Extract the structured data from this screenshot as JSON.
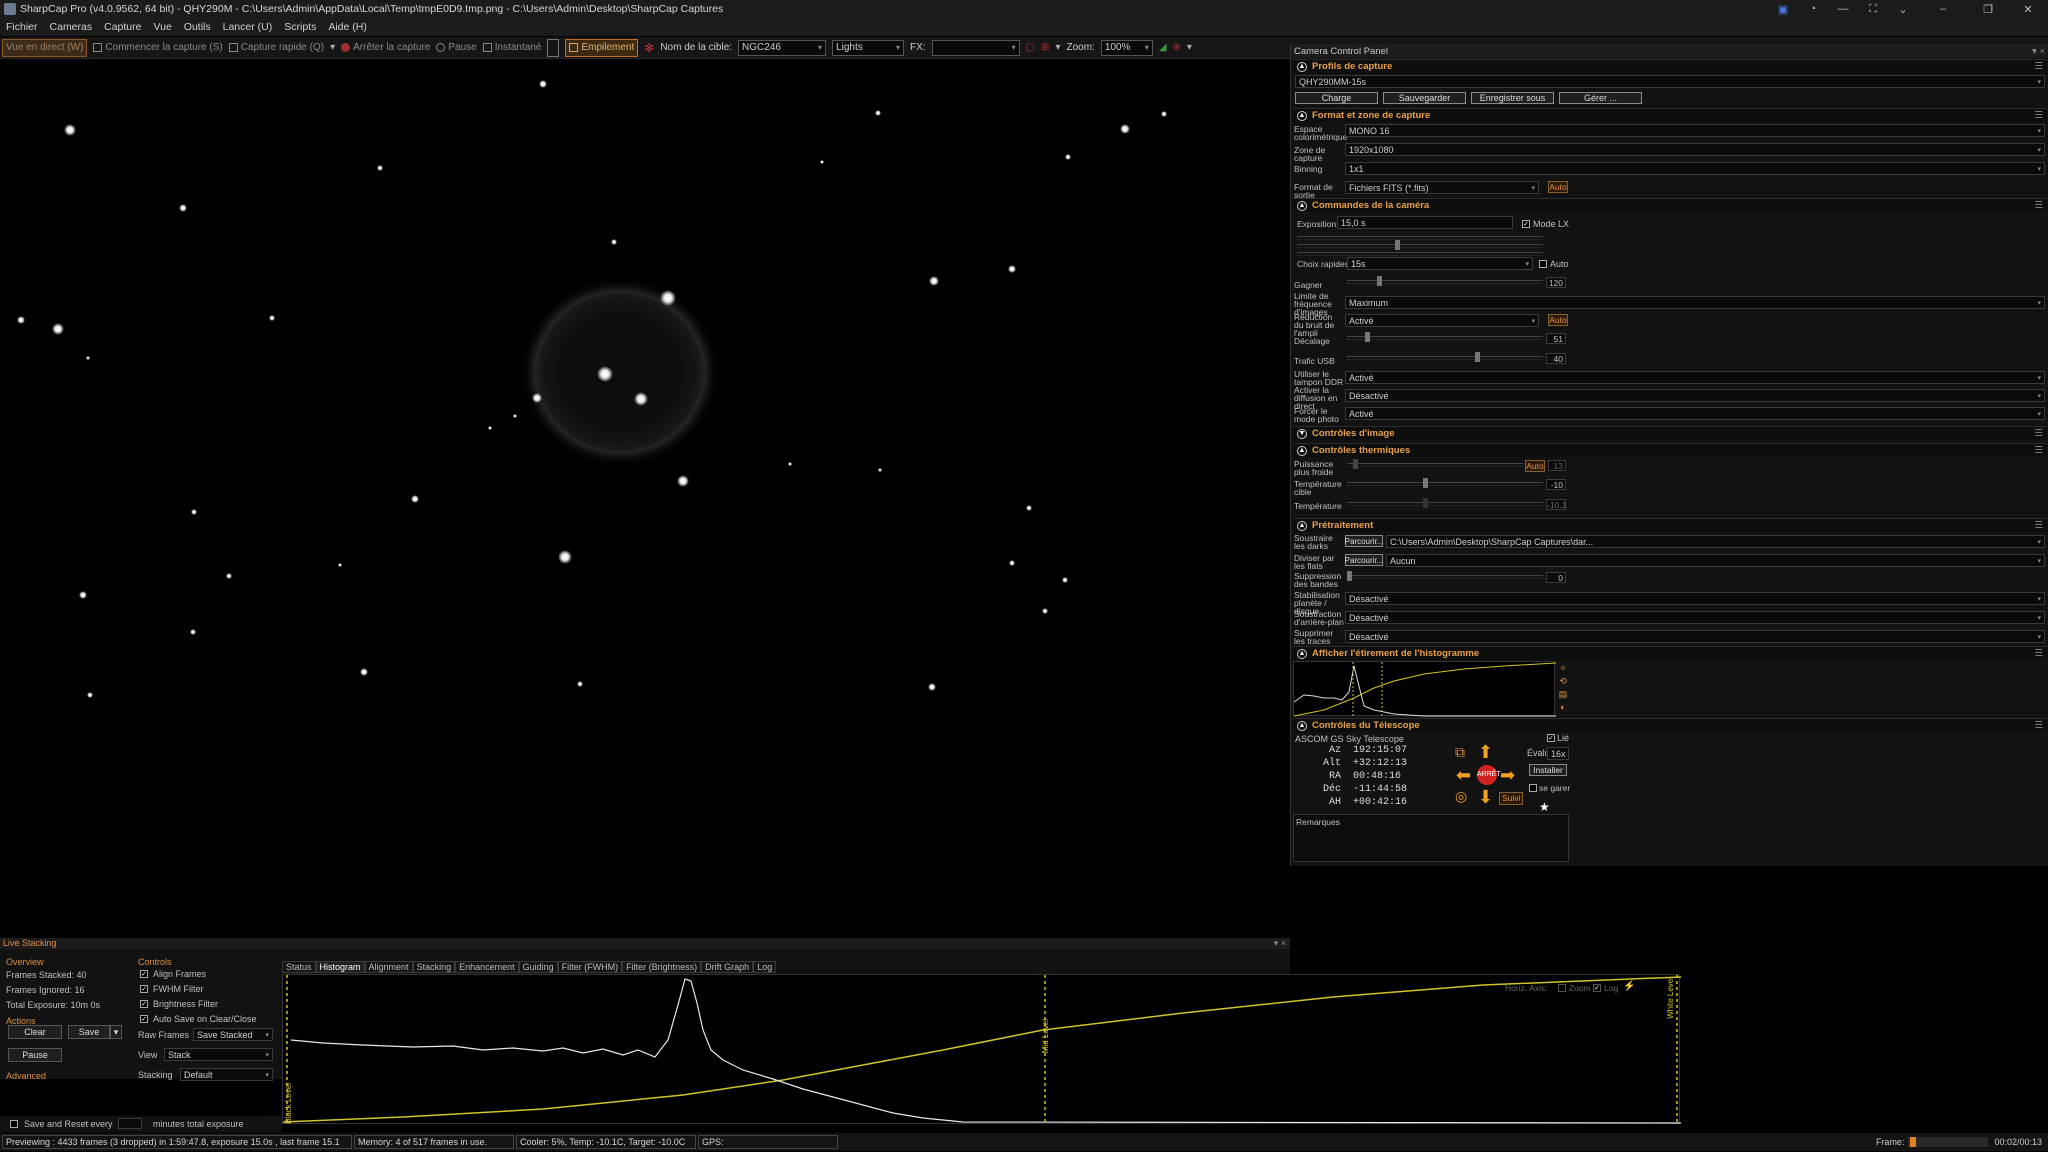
{
  "window": {
    "title": "SharpCap Pro (v4.0.9562, 64 bit) - QHY290M - C:\\Users\\Admin\\AppData\\Local\\Temp\\tmpE0D9.tmp.png - C:\\Users\\Admin\\Desktop\\SharpCap Captures"
  },
  "menu": [
    "Fichier",
    "Cameras",
    "Capture",
    "Vue",
    "Outils",
    "Lancer (U)",
    "Scripts",
    "Aide (H)"
  ],
  "toolbar": {
    "live": "Vue en direct (W)",
    "start": "Commencer la capture (S)",
    "quick": "Capture rapide (Q)",
    "stop": "Arrêter la capture",
    "pause": "Pause",
    "snapshot": "Instantané",
    "stacking": "Empilement",
    "target_label": "Nom de la cible:",
    "target": "NGC246",
    "frame_type": "Lights",
    "fx_label": "FX:",
    "fx": "",
    "zoom_label": "Zoom:",
    "zoom": "100%"
  },
  "panel": {
    "title": "Camera Control Panel",
    "profiles": {
      "header": "Profils de capture",
      "selected": "QHY290MM-15s",
      "buttons": [
        "Charge",
        "Sauvegarder",
        "Enregistrer sous",
        "Gérer ..."
      ]
    },
    "format": {
      "header": "Format et zone de capture",
      "rows": [
        {
          "label": "Espace colorimétrique",
          "value": "MONO 16"
        },
        {
          "label": "Zone de capture",
          "value": "1920x1080"
        },
        {
          "label": "Binning",
          "value": "1x1"
        },
        {
          "label": "Format de sortie",
          "value": "Fichiers FITS (*.fits)"
        }
      ],
      "auto": "Auto"
    },
    "camera": {
      "header": "Commandes de la caméra",
      "exposure_label": "Exposition",
      "exposure": "15,0 s",
      "lx_mode": "Mode LX",
      "quick_label": "Choix rapides",
      "quick": "15s",
      "auto": "Auto",
      "rows": [
        {
          "label": "Gagner",
          "value": "120"
        },
        {
          "label": "Limite de fréquence d'images",
          "value": "Maximum"
        },
        {
          "label": "Réduction du bruit de l'ampli",
          "value": "Activé"
        },
        {
          "label": "Décalage",
          "value": "51"
        },
        {
          "label": "Trafic USB",
          "value": "40"
        },
        {
          "label": "Utiliser le tampon DDR",
          "value": "Activé"
        },
        {
          "label": "Activer la diffusion en direct",
          "value": "Désactivé"
        },
        {
          "label": "Forcer le mode photo",
          "value": "Activé"
        }
      ]
    },
    "image_controls": {
      "header": "Contrôles d'image"
    },
    "thermal": {
      "header": "Contrôles thermiques",
      "rows": [
        {
          "label": "Puissance plus froide",
          "value": "13"
        },
        {
          "label": "Température cible",
          "value": "-10"
        },
        {
          "label": "Température",
          "value": "-10.1"
        }
      ],
      "auto": "Auto"
    },
    "preprocessing": {
      "header": "Prétraitement",
      "browse": "Parcourir...",
      "rows": [
        {
          "label": "Soustraire les darks",
          "value": "C:\\Users\\Admin\\Desktop\\SharpCap Captures\\dar..."
        },
        {
          "label": "Diviser par les flats",
          "value": "Aucun"
        },
        {
          "label": "Suppression des bandes",
          "value": "0"
        },
        {
          "label": "Stabilisation planète / disque",
          "value": "Désactivé"
        },
        {
          "label": "Soustraction d'arrière-plan",
          "value": "Désactivé"
        },
        {
          "label": "Supprimer les traces satellites",
          "value": "Désactivé"
        }
      ]
    },
    "histogram": {
      "header": "Afficher l'étirement de l'histogramme"
    },
    "telescope": {
      "header": "Contrôles du Télescope",
      "name": "ASCOM GS Sky Telescope",
      "linked": "Lié",
      "evaluate_label": "Évaluer:",
      "evaluate": "16x",
      "install": "Installer",
      "park": "se garer",
      "stop": "ARRÊT",
      "follow": "Suivi",
      "coords": [
        {
          "k": "Az",
          "v": "192:15:07"
        },
        {
          "k": "Alt",
          "v": "+32:12:13"
        },
        {
          "k": "RA",
          "v": "00:48:16"
        },
        {
          "k": "Déc",
          "v": "-11:44:58"
        },
        {
          "k": "AH",
          "v": "+00:42:16"
        }
      ],
      "notes": "Remarques"
    }
  },
  "live_stacking": {
    "title": "Live Stacking",
    "overview": "Overview",
    "stacked": "Frames Stacked: 40",
    "ignored": "Frames Ignored: 16",
    "total": "Total Exposure:   10m 0s",
    "actions": "Actions",
    "clear": "Clear",
    "save": "Save",
    "pause": "Pause",
    "advanced": "Advanced",
    "save_reset": "Save and Reset every",
    "minutes": "minutes total exposure",
    "minutes_value": "",
    "controls": "Controls",
    "checks": [
      "Align Frames",
      "FWHM Filter",
      "Brightness Filter",
      "Auto Save on Clear/Close"
    ],
    "raw_label": "Raw Frames",
    "raw": "Save Stacked",
    "view_label": "View",
    "view": "Stack",
    "stacking_label": "Stacking",
    "stacking": "Default",
    "tabs": [
      "Status",
      "Histogram",
      "Alignment",
      "Stacking",
      "Enhancement",
      "Guiding",
      "Filter (FWHM)",
      "Filter (Brightness)",
      "Drift Graph",
      "Log"
    ],
    "horiz": "Horiz. Axis:",
    "zoom": "Zoom",
    "log": "Log",
    "black": "Black Level",
    "mid": "Mid Level",
    "white": "White Level"
  },
  "status": {
    "preview": "Previewing : 4433 frames (3 dropped) in 1:59:47.8, exposure 15.0s , last frame 15.1",
    "memory": "Memory: 4 of 517 frames in use.",
    "cooler": "Cooler: 5%, Temp: -10.1C, Target: -10.0C",
    "gps": "GPS:",
    "frame_label": "Frame:",
    "time": "00:02/00:13"
  }
}
